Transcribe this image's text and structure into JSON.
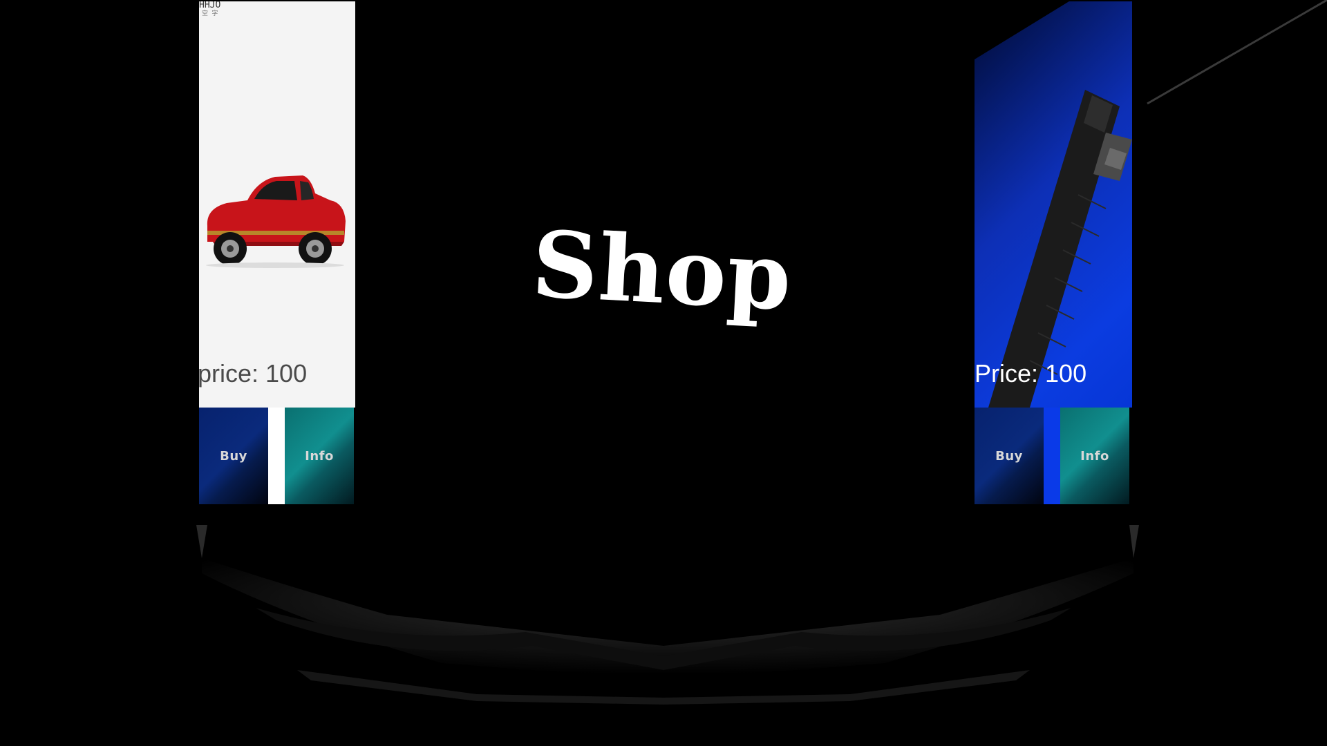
{
  "scene": {
    "title": "Shop",
    "background_color": "#000000"
  },
  "items": [
    {
      "image": "red-classic-car",
      "logo_text": "HHJO",
      "logo_sub": "空 字",
      "price_label": "price: 100",
      "buy_label": "Buy",
      "info_label": "Info",
      "card_color": "#f4f4f4"
    },
    {
      "image": "black-flashlight",
      "price_label": "Price: 100",
      "buy_label": "Buy",
      "info_label": "Info",
      "card_color": "#0b3ce0"
    }
  ],
  "colors": {
    "buy_button": "#0a2a7c",
    "info_button": "#118f8f",
    "price_text_light": "#ffffff",
    "price_text_dark": "#4a4a4a"
  }
}
